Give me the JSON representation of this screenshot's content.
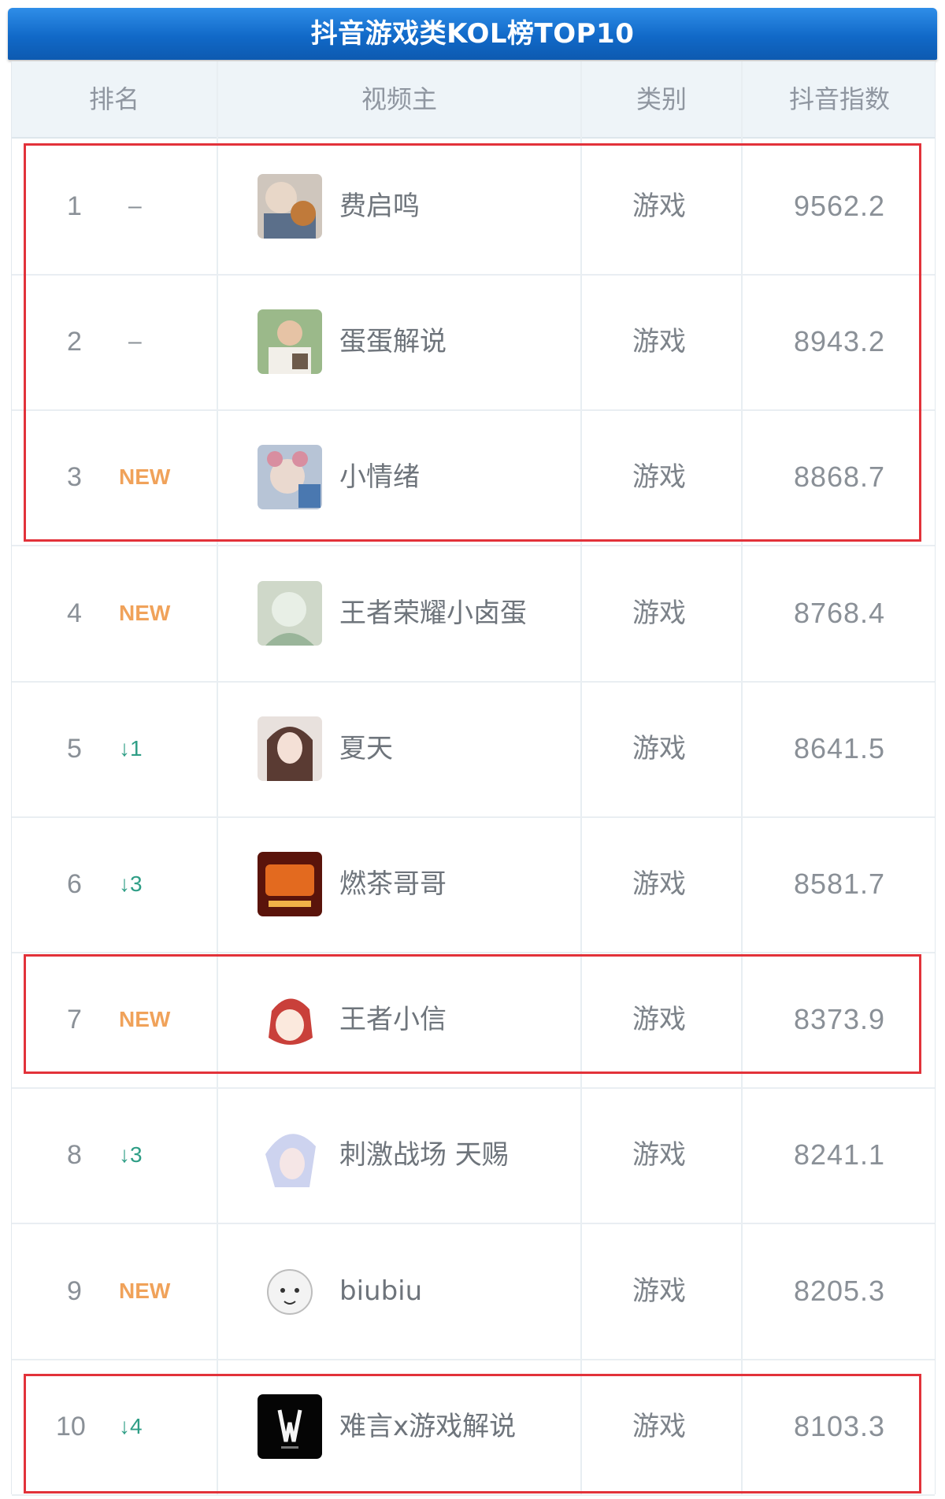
{
  "title": "抖音游戏类KOL榜TOP10",
  "columns": {
    "rank": "排名",
    "creator": "视频主",
    "category": "类别",
    "index": "抖音指数"
  },
  "colors": {
    "highlight": "#e2323a",
    "new_badge": "#f0a25a",
    "down_arrow": "#2f9e86",
    "header_bar": "#1169c8"
  },
  "rows": [
    {
      "rank": "1",
      "change": "–",
      "change_type": "same",
      "name": "费启鸣",
      "category": "游戏",
      "index": "9562.2",
      "avatar": "费启鸣-avatar"
    },
    {
      "rank": "2",
      "change": "–",
      "change_type": "same",
      "name": "蛋蛋解说",
      "category": "游戏",
      "index": "8943.2",
      "avatar": "蛋蛋解说-avatar"
    },
    {
      "rank": "3",
      "change": "NEW",
      "change_type": "new",
      "name": "小情绪",
      "category": "游戏",
      "index": "8868.7",
      "avatar": "小情绪-avatar"
    },
    {
      "rank": "4",
      "change": "NEW",
      "change_type": "new",
      "name": "王者荣耀小卤蛋",
      "category": "游戏",
      "index": "8768.4",
      "avatar": "王者荣耀小卤蛋-avatar"
    },
    {
      "rank": "5",
      "change": "↓1",
      "change_type": "down",
      "name": "夏天",
      "category": "游戏",
      "index": "8641.5",
      "avatar": "夏天-avatar"
    },
    {
      "rank": "6",
      "change": "↓3",
      "change_type": "down",
      "name": "燃茶哥哥",
      "category": "游戏",
      "index": "8581.7",
      "avatar": "燃茶哥哥-avatar"
    },
    {
      "rank": "7",
      "change": "NEW",
      "change_type": "new",
      "name": "王者小信",
      "category": "游戏",
      "index": "8373.9",
      "avatar": "王者小信-avatar"
    },
    {
      "rank": "8",
      "change": "↓3",
      "change_type": "down",
      "name": "刺激战场 天赐",
      "category": "游戏",
      "index": "8241.1",
      "avatar": "刺激战场天赐-avatar"
    },
    {
      "rank": "9",
      "change": "NEW",
      "change_type": "new",
      "name": "biubiu",
      "category": "游戏",
      "index": "8205.3",
      "avatar": "biubiu-avatar"
    },
    {
      "rank": "10",
      "change": "↓4",
      "change_type": "down",
      "name": "难言x游戏解说",
      "category": "游戏",
      "index": "8103.3",
      "avatar": "难言x游戏解说-avatar"
    }
  ]
}
